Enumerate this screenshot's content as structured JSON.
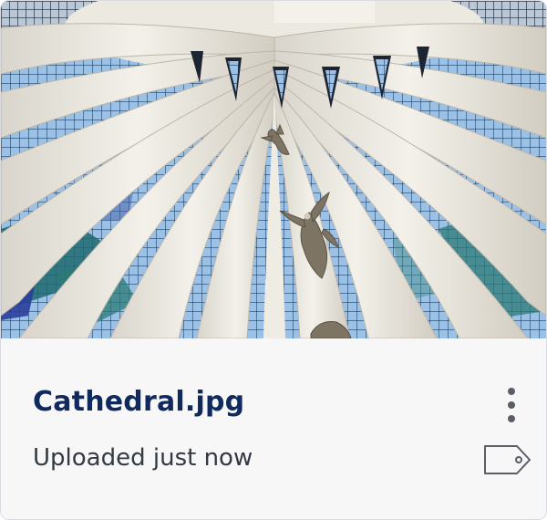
{
  "file": {
    "name": "Cathedral.jpg",
    "status": "Uploaded just now"
  },
  "icons": {
    "more": "more-vertical-icon",
    "tag": "tag-icon"
  },
  "colors": {
    "title": "#112a5e",
    "status": "#333a44",
    "icon": "#5a5f66",
    "card_bg": "#f7f7f8"
  }
}
